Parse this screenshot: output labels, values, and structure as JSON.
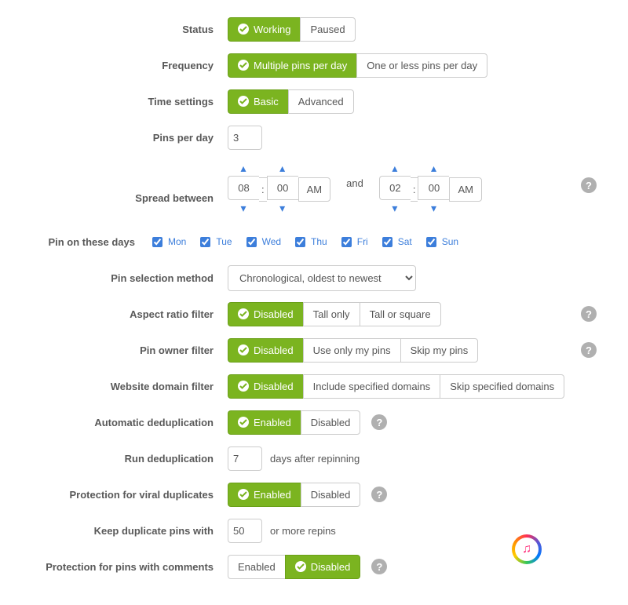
{
  "status": {
    "label": "Status",
    "working": "Working",
    "paused": "Paused"
  },
  "frequency": {
    "label": "Frequency",
    "multiple": "Multiple pins per day",
    "single": "One or less pins per day"
  },
  "timeSettings": {
    "label": "Time settings",
    "basic": "Basic",
    "advanced": "Advanced"
  },
  "pinsPerDay": {
    "label": "Pins per day",
    "value": "3"
  },
  "spread": {
    "label": "Spread between",
    "from": {
      "hh": "08",
      "mm": "00",
      "ampm": "AM"
    },
    "and": "and",
    "to": {
      "hh": "02",
      "mm": "00",
      "ampm": "AM"
    }
  },
  "days": {
    "label": "Pin on these days",
    "items": [
      {
        "label": "Mon",
        "checked": true
      },
      {
        "label": "Tue",
        "checked": true
      },
      {
        "label": "Wed",
        "checked": true
      },
      {
        "label": "Thu",
        "checked": true
      },
      {
        "label": "Fri",
        "checked": true
      },
      {
        "label": "Sat",
        "checked": true
      },
      {
        "label": "Sun",
        "checked": true
      }
    ]
  },
  "selection": {
    "label": "Pin selection method",
    "value": "Chronological, oldest to newest"
  },
  "aspect": {
    "label": "Aspect ratio filter",
    "disabled": "Disabled",
    "tall": "Tall only",
    "tallSquare": "Tall or square"
  },
  "owner": {
    "label": "Pin owner filter",
    "disabled": "Disabled",
    "mine": "Use only my pins",
    "skip": "Skip my pins"
  },
  "domain": {
    "label": "Website domain filter",
    "disabled": "Disabled",
    "include": "Include specified domains",
    "skip": "Skip specified domains"
  },
  "dedup": {
    "label": "Automatic deduplication",
    "enabled": "Enabled",
    "disabled": "Disabled"
  },
  "runDedup": {
    "label": "Run deduplication",
    "value": "7",
    "suffix": "days after repinning"
  },
  "viral": {
    "label": "Protection for viral duplicates",
    "enabled": "Enabled",
    "disabled": "Disabled"
  },
  "keepDup": {
    "label": "Keep duplicate pins with",
    "value": "50",
    "suffix": "or more repins"
  },
  "comments": {
    "label": "Protection for pins with comments",
    "enabled": "Enabled",
    "disabled": "Disabled"
  }
}
